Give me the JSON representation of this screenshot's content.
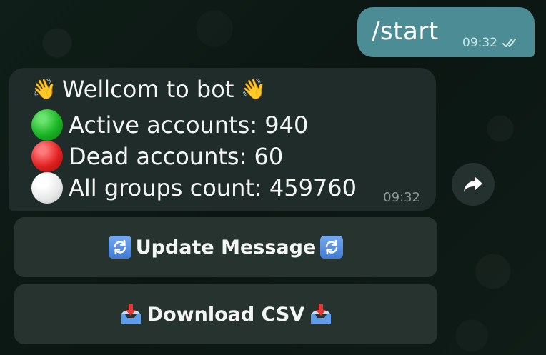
{
  "outgoing": {
    "text": "/start",
    "time": "09:32",
    "status": "double-check-read"
  },
  "incoming": {
    "lines": [
      {
        "icon": "waving-hand-icon",
        "text": "Wellcom to bot",
        "trailing_icon": "waving-hand-icon"
      },
      {
        "icon": "green-circle-icon",
        "text": "Active accounts: 940"
      },
      {
        "icon": "red-circle-icon",
        "text": "Dead accounts: 60"
      },
      {
        "icon": "white-circle-icon",
        "text": "All groups count: 459760"
      }
    ],
    "time": "09:32"
  },
  "buttons": [
    {
      "label": "Update Message",
      "icon": "arrows-refresh-icon"
    },
    {
      "label": "Download CSV",
      "icon": "inbox-tray-icon"
    }
  ],
  "colors": {
    "outgoing_bubble": "#4c8c95",
    "incoming_bubble": "#1f2c29",
    "button_bg": "#27332f",
    "background": "#0e1a15"
  }
}
